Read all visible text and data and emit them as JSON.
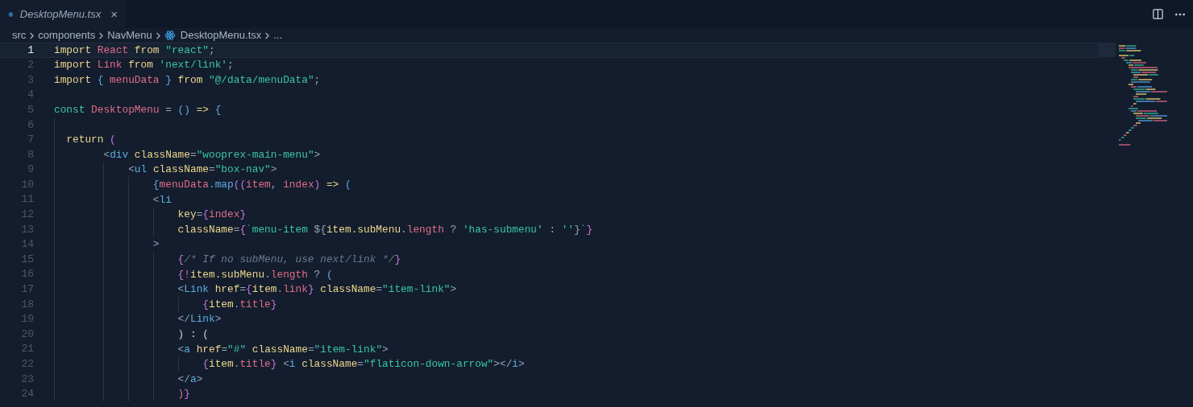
{
  "tab": {
    "title": "DesktopMenu.tsx",
    "italic": true,
    "close": "×"
  },
  "breadcrumbs": [
    "src",
    "components",
    "NavMenu",
    "DesktopMenu.tsx",
    "..."
  ],
  "lines": [
    {
      "number": "1",
      "selected": true,
      "tokens": [
        {
          "text": "import",
          "kind": "keyword"
        },
        {
          "text": " React",
          "kind": "identifier"
        },
        {
          "text": " from",
          "kind": "keyword"
        },
        {
          "text": " \"react\"",
          "kind": "string"
        },
        {
          "text": ";",
          "kind": "operator"
        }
      ]
    },
    {
      "number": "2",
      "selected": false,
      "tokens": [
        {
          "text": "import",
          "kind": "keyword"
        },
        {
          "text": " Link",
          "kind": "identifier"
        },
        {
          "text": " from",
          "kind": "keyword"
        },
        {
          "text": " 'next/link'",
          "kind": "string"
        },
        {
          "text": ";",
          "kind": "operator"
        }
      ]
    },
    {
      "number": "3",
      "selected": false,
      "tokens": [
        {
          "text": "import",
          "kind": "keyword"
        },
        {
          "text": " {",
          "kind": "bracket"
        },
        {
          "text": " menuData",
          "kind": "identifier"
        },
        {
          "text": " }",
          "kind": "bracket"
        },
        {
          "text": " from",
          "kind": "keyword"
        },
        {
          "text": " \"@/data/menuData\"",
          "kind": "string"
        },
        {
          "text": ";",
          "kind": "operator"
        }
      ]
    },
    {
      "number": "4",
      "selected": false
    },
    {
      "number": "5",
      "selected": false,
      "tokens": [
        {
          "text": "const",
          "kind": "string"
        },
        {
          "text": " DesktopMenu",
          "kind": "identifier"
        },
        {
          "text": " =",
          "kind": "operator"
        },
        {
          "text": " ()",
          "kind": "bracket"
        },
        {
          "text": " =>",
          "kind": "keyword"
        },
        {
          "text": " {",
          "kind": "bracket"
        }
      ]
    },
    {
      "number": "6",
      "selected": false
    },
    {
      "number": "7",
      "selected": false,
      "tokens": [
        {
          "text": "  return",
          "kind": "keyword"
        },
        {
          "text": " (",
          "kind": "brace"
        }
      ]
    },
    {
      "number": "8",
      "selected": false,
      "tokens": [
        {
          "text": "        <",
          "kind": "angle"
        },
        {
          "text": "div",
          "kind": "tag"
        },
        {
          "text": " className",
          "kind": "keyword"
        },
        {
          "text": "=",
          "kind": "operator"
        },
        {
          "text": "\"wooprex-main-menu\"",
          "kind": "string"
        },
        {
          "text": ">",
          "kind": "angle"
        }
      ]
    },
    {
      "number": "9",
      "selected": false,
      "tokens": [
        {
          "text": "            <",
          "kind": "angle"
        },
        {
          "text": "ul",
          "kind": "tag"
        },
        {
          "text": " className",
          "kind": "keyword"
        },
        {
          "text": "=",
          "kind": "operator"
        },
        {
          "text": "\"box-nav\"",
          "kind": "string"
        },
        {
          "text": ">",
          "kind": "angle"
        }
      ]
    },
    {
      "number": "10",
      "selected": false,
      "tokens": [
        {
          "text": "                {",
          "kind": "bracket"
        },
        {
          "text": "menuData",
          "kind": "identifier"
        },
        {
          "text": ".map",
          "kind": "bracket"
        },
        {
          "text": "((",
          "kind": "brace"
        },
        {
          "text": "item",
          "kind": "identifier"
        },
        {
          "text": ",",
          "kind": "operator"
        },
        {
          "text": " index",
          "kind": "identifier"
        },
        {
          "text": ")",
          "kind": "brace"
        },
        {
          "text": " =>",
          "kind": "keyword"
        },
        {
          "text": " (",
          "kind": "bracket"
        }
      ]
    },
    {
      "number": "11",
      "selected": false,
      "tokens": [
        {
          "text": "                <",
          "kind": "angle"
        },
        {
          "text": "li",
          "kind": "tag"
        }
      ]
    },
    {
      "number": "12",
      "selected": false,
      "tokens": [
        {
          "text": "                    key",
          "kind": "keyword"
        },
        {
          "text": "=",
          "kind": "operator"
        },
        {
          "text": "{",
          "kind": "brace"
        },
        {
          "text": "index",
          "kind": "identifier"
        },
        {
          "text": "}",
          "kind": "brace"
        }
      ]
    },
    {
      "number": "13",
      "selected": false,
      "tokens": [
        {
          "text": "                    className",
          "kind": "keyword"
        },
        {
          "text": "=",
          "kind": "operator"
        },
        {
          "text": "{",
          "kind": "brace"
        },
        {
          "text": "`menu-item ",
          "kind": "string"
        },
        {
          "text": "${",
          "kind": "operator"
        },
        {
          "text": "item.subMenu",
          "kind": "keyword"
        },
        {
          "text": ".",
          "kind": "operator"
        },
        {
          "text": "length",
          "kind": "identifier"
        },
        {
          "text": " ?",
          "kind": "operator"
        },
        {
          "text": " 'has-submenu'",
          "kind": "string"
        },
        {
          "text": " :",
          "kind": "operator"
        },
        {
          "text": " ''",
          "kind": "string"
        },
        {
          "text": "}",
          "kind": "operator"
        },
        {
          "text": "`",
          "kind": "string"
        },
        {
          "text": "}",
          "kind": "brace"
        }
      ]
    },
    {
      "number": "14",
      "selected": false,
      "tokens": [
        {
          "text": "                >",
          "kind": "angle"
        }
      ]
    },
    {
      "number": "15",
      "selected": false,
      "tokens": [
        {
          "text": "                    {",
          "kind": "brace"
        },
        {
          "text": "/* If no subMenu, use next/link */",
          "kind": "comment"
        },
        {
          "text": "}",
          "kind": "brace"
        }
      ]
    },
    {
      "number": "16",
      "selected": false,
      "tokens": [
        {
          "text": "                    {",
          "kind": "brace"
        },
        {
          "text": "!",
          "kind": "identifier"
        },
        {
          "text": "item.subMenu",
          "kind": "keyword"
        },
        {
          "text": ".",
          "kind": "operator"
        },
        {
          "text": "length",
          "kind": "identifier"
        },
        {
          "text": " ?",
          "kind": "operator"
        },
        {
          "text": " (",
          "kind": "bracket"
        }
      ]
    },
    {
      "number": "17",
      "selected": false,
      "tokens": [
        {
          "text": "                    <",
          "kind": "angle"
        },
        {
          "text": "Link",
          "kind": "tag"
        },
        {
          "text": " href",
          "kind": "keyword"
        },
        {
          "text": "=",
          "kind": "operator"
        },
        {
          "text": "{",
          "kind": "brace"
        },
        {
          "text": "item",
          "kind": "keyword"
        },
        {
          "text": ".",
          "kind": "operator"
        },
        {
          "text": "link",
          "kind": "identifier"
        },
        {
          "text": "}",
          "kind": "brace"
        },
        {
          "text": " className",
          "kind": "keyword"
        },
        {
          "text": "=",
          "kind": "operator"
        },
        {
          "text": "\"item-link\"",
          "kind": "string"
        },
        {
          "text": ">",
          "kind": "angle"
        }
      ]
    },
    {
      "number": "18",
      "selected": false,
      "tokens": [
        {
          "text": "                        {",
          "kind": "brace"
        },
        {
          "text": "item",
          "kind": "keyword"
        },
        {
          "text": ".",
          "kind": "operator"
        },
        {
          "text": "title",
          "kind": "identifier"
        },
        {
          "text": "}",
          "kind": "brace"
        }
      ]
    },
    {
      "number": "19",
      "selected": false,
      "tokens": [
        {
          "text": "                    </",
          "kind": "angle"
        },
        {
          "text": "Link",
          "kind": "tag"
        },
        {
          "text": ">",
          "kind": "angle"
        }
      ]
    },
    {
      "number": "20",
      "selected": false,
      "tokens": [
        {
          "text": "                    ) : (",
          "kind": "plain"
        }
      ]
    },
    {
      "number": "21",
      "selected": false,
      "tokens": [
        {
          "text": "                    <",
          "kind": "angle"
        },
        {
          "text": "a",
          "kind": "tag"
        },
        {
          "text": " href",
          "kind": "keyword"
        },
        {
          "text": "=",
          "kind": "operator"
        },
        {
          "text": "\"#\"",
          "kind": "string"
        },
        {
          "text": " className",
          "kind": "keyword"
        },
        {
          "text": "=",
          "kind": "operator"
        },
        {
          "text": "\"item-link\"",
          "kind": "string"
        },
        {
          "text": ">",
          "kind": "angle"
        }
      ]
    },
    {
      "number": "22",
      "selected": false,
      "tokens": [
        {
          "text": "                        {",
          "kind": "brace"
        },
        {
          "text": "item",
          "kind": "keyword"
        },
        {
          "text": ".",
          "kind": "operator"
        },
        {
          "text": "title",
          "kind": "identifier"
        },
        {
          "text": "}",
          "kind": "brace"
        },
        {
          "text": " <",
          "kind": "angle"
        },
        {
          "text": "i",
          "kind": "tag"
        },
        {
          "text": " className",
          "kind": "keyword"
        },
        {
          "text": "=",
          "kind": "operator"
        },
        {
          "text": "\"flaticon-down-arrow\"",
          "kind": "string"
        },
        {
          "text": "></",
          "kind": "angle"
        },
        {
          "text": "i",
          "kind": "tag"
        },
        {
          "text": ">",
          "kind": "angle"
        }
      ]
    },
    {
      "number": "23",
      "selected": false,
      "tokens": [
        {
          "text": "                    </",
          "kind": "angle"
        },
        {
          "text": "a",
          "kind": "tag"
        },
        {
          "text": ">",
          "kind": "angle"
        }
      ]
    },
    {
      "number": "24",
      "selected": false,
      "tokens": [
        {
          "text": "                    )",
          "kind": "identifier"
        },
        {
          "text": "}",
          "kind": "brace"
        }
      ]
    }
  ]
}
